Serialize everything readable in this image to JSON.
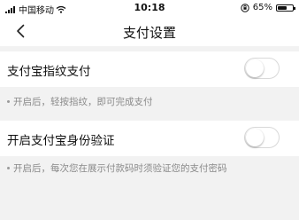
{
  "status_bar": {
    "carrier": "中国移动",
    "time": "10:18",
    "battery_percent": "65%",
    "battery_level": 0.65,
    "icons": [
      "signal-icon",
      "wifi-icon",
      "orientation-lock-icon",
      "battery-icon"
    ]
  },
  "nav": {
    "title": "支付设置",
    "back_icon": "chevron-left-icon"
  },
  "settings": [
    {
      "label": "支付宝指纹支付",
      "enabled": false,
      "hint": "开启后，轻按指纹，即可完成支付"
    },
    {
      "label": "开启支付宝身份验证",
      "enabled": false,
      "hint": "开启后，每次您在展示付款码时须验证您的支付密码"
    }
  ],
  "colors": {
    "page_background": "#f2f2f2",
    "hint_text": "#8a8a8a",
    "toggle_border": "#d9d9d9"
  }
}
